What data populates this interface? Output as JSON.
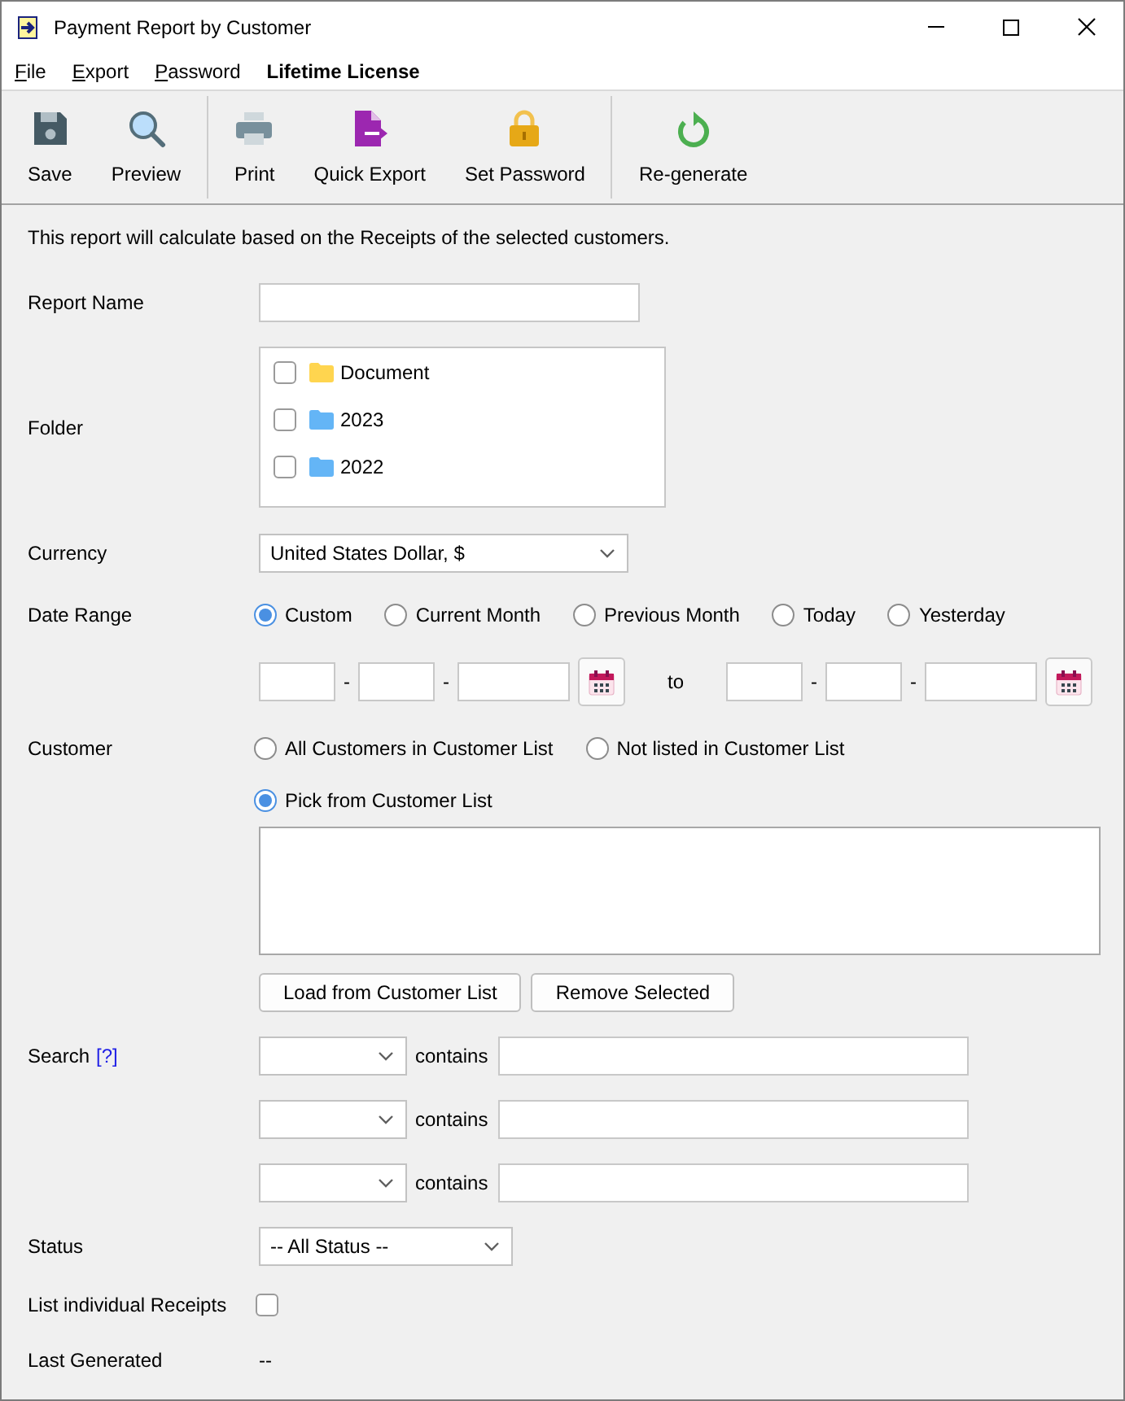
{
  "window": {
    "title": "Payment Report by Customer"
  },
  "menu": [
    {
      "label": "File",
      "kind": "menu"
    },
    {
      "label": "Export",
      "kind": "menu"
    },
    {
      "label": "Password",
      "kind": "menu"
    },
    {
      "label": "Lifetime License",
      "kind": "notice"
    }
  ],
  "toolbar": [
    [
      {
        "label": "Save",
        "kind": "save"
      },
      {
        "label": "Preview",
        "kind": "preview"
      }
    ],
    [
      {
        "label": "Print",
        "kind": "print"
      },
      {
        "label": "Quick Export",
        "kind": "export"
      },
      {
        "label": "Set Password",
        "kind": "password"
      }
    ],
    [
      {
        "label": "Re-generate",
        "kind": "regenerate"
      }
    ]
  ],
  "form": {
    "description": "This report will calculate based on the Receipts of the selected customers.",
    "report_name": {
      "label": "Report Name"
    },
    "folder": {
      "label": "Folder",
      "items": [
        {
          "label": "Document",
          "checked": false,
          "color": "#ffd54f"
        },
        {
          "label": "2023",
          "checked": false,
          "color": "#64b5f6"
        },
        {
          "label": "2022",
          "checked": false,
          "color": "#64b5f6"
        }
      ]
    },
    "currency": {
      "label": "Currency",
      "value": "United States Dollar, $"
    },
    "date_range": {
      "label": "Date Range",
      "options": [
        {
          "label": "Custom",
          "selected": true
        },
        {
          "label": "Current Month",
          "selected": false
        },
        {
          "label": "Previous Month",
          "selected": false
        },
        {
          "label": "Today",
          "selected": false
        },
        {
          "label": "Yesterday",
          "selected": false
        }
      ],
      "from": {
        "separators": [
          "-",
          "-"
        ]
      },
      "to_label": "to",
      "to": {
        "separators": [
          "-",
          "-"
        ]
      }
    },
    "customer": {
      "label": "Customer",
      "options": [
        {
          "label": "All Customers in Customer List",
          "selected": false
        },
        {
          "label": "Not listed in Customer List",
          "selected": false
        },
        {
          "label": "Pick from Customer List",
          "selected": true
        }
      ],
      "buttons": [
        "Load from Customer List",
        "Remove Selected"
      ]
    },
    "search": {
      "label": "Search",
      "help": "[?]",
      "rows": [
        {
          "operator": "contains"
        },
        {
          "operator": "contains"
        },
        {
          "operator": "contains"
        }
      ]
    },
    "status": {
      "label": "Status",
      "value": "-- All Status --"
    },
    "list_individual_receipts": {
      "label": "List individual Receipts",
      "checked": false
    },
    "last_generated": {
      "label": "Last Generated",
      "value": "--"
    }
  }
}
